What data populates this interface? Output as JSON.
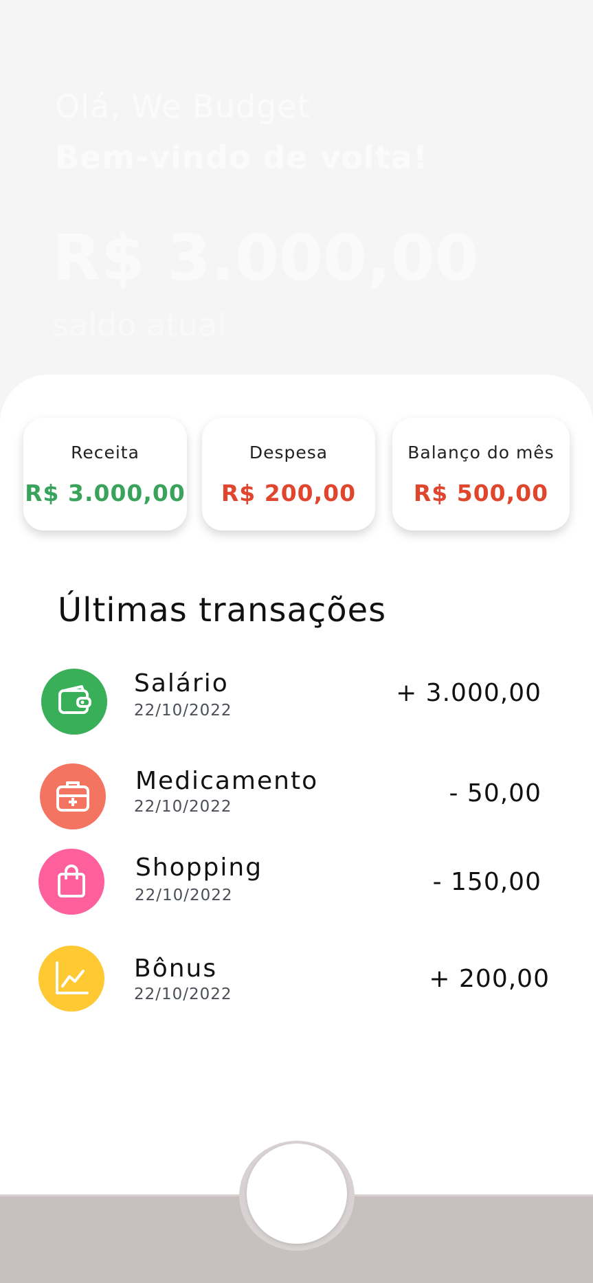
{
  "header": {
    "greeting": "Olá, We Budget",
    "welcome": "Bem-vindo de volta!",
    "balance": "R$ 3.000,00",
    "balance_caption": "saldo atual"
  },
  "summary": {
    "income": {
      "label": "Receita",
      "value": "R$ 3.000,00",
      "color": "#3aa35b"
    },
    "expense": {
      "label": "Despesa",
      "value": "R$ 200,00",
      "color": "#e0452e"
    },
    "monthly_balance": {
      "label": "Balanço do mês",
      "value": "R$ 500,00",
      "color": "#e0452e"
    }
  },
  "transactions_title": "Últimas transações",
  "transactions": [
    {
      "name": "Salário",
      "date": "22/10/2022",
      "amount": "+ 3.000,00",
      "icon": "wallet-icon",
      "color": "#3aaf5a"
    },
    {
      "name": "Medicamento",
      "date": "22/10/2022",
      "amount": "- 50,00",
      "icon": "medical-kit-icon",
      "color": "#f47462"
    },
    {
      "name": "Shopping",
      "date": "22/10/2022",
      "amount": "- 150,00",
      "icon": "shopping-bag-icon",
      "color": "#fe5f9d"
    },
    {
      "name": "Bônus",
      "date": "22/10/2022",
      "amount": "+ 200,00",
      "icon": "chart-line-icon",
      "color": "#ffc933"
    }
  ],
  "bottom_nav": {
    "bar_color": "#c8c0c0"
  }
}
